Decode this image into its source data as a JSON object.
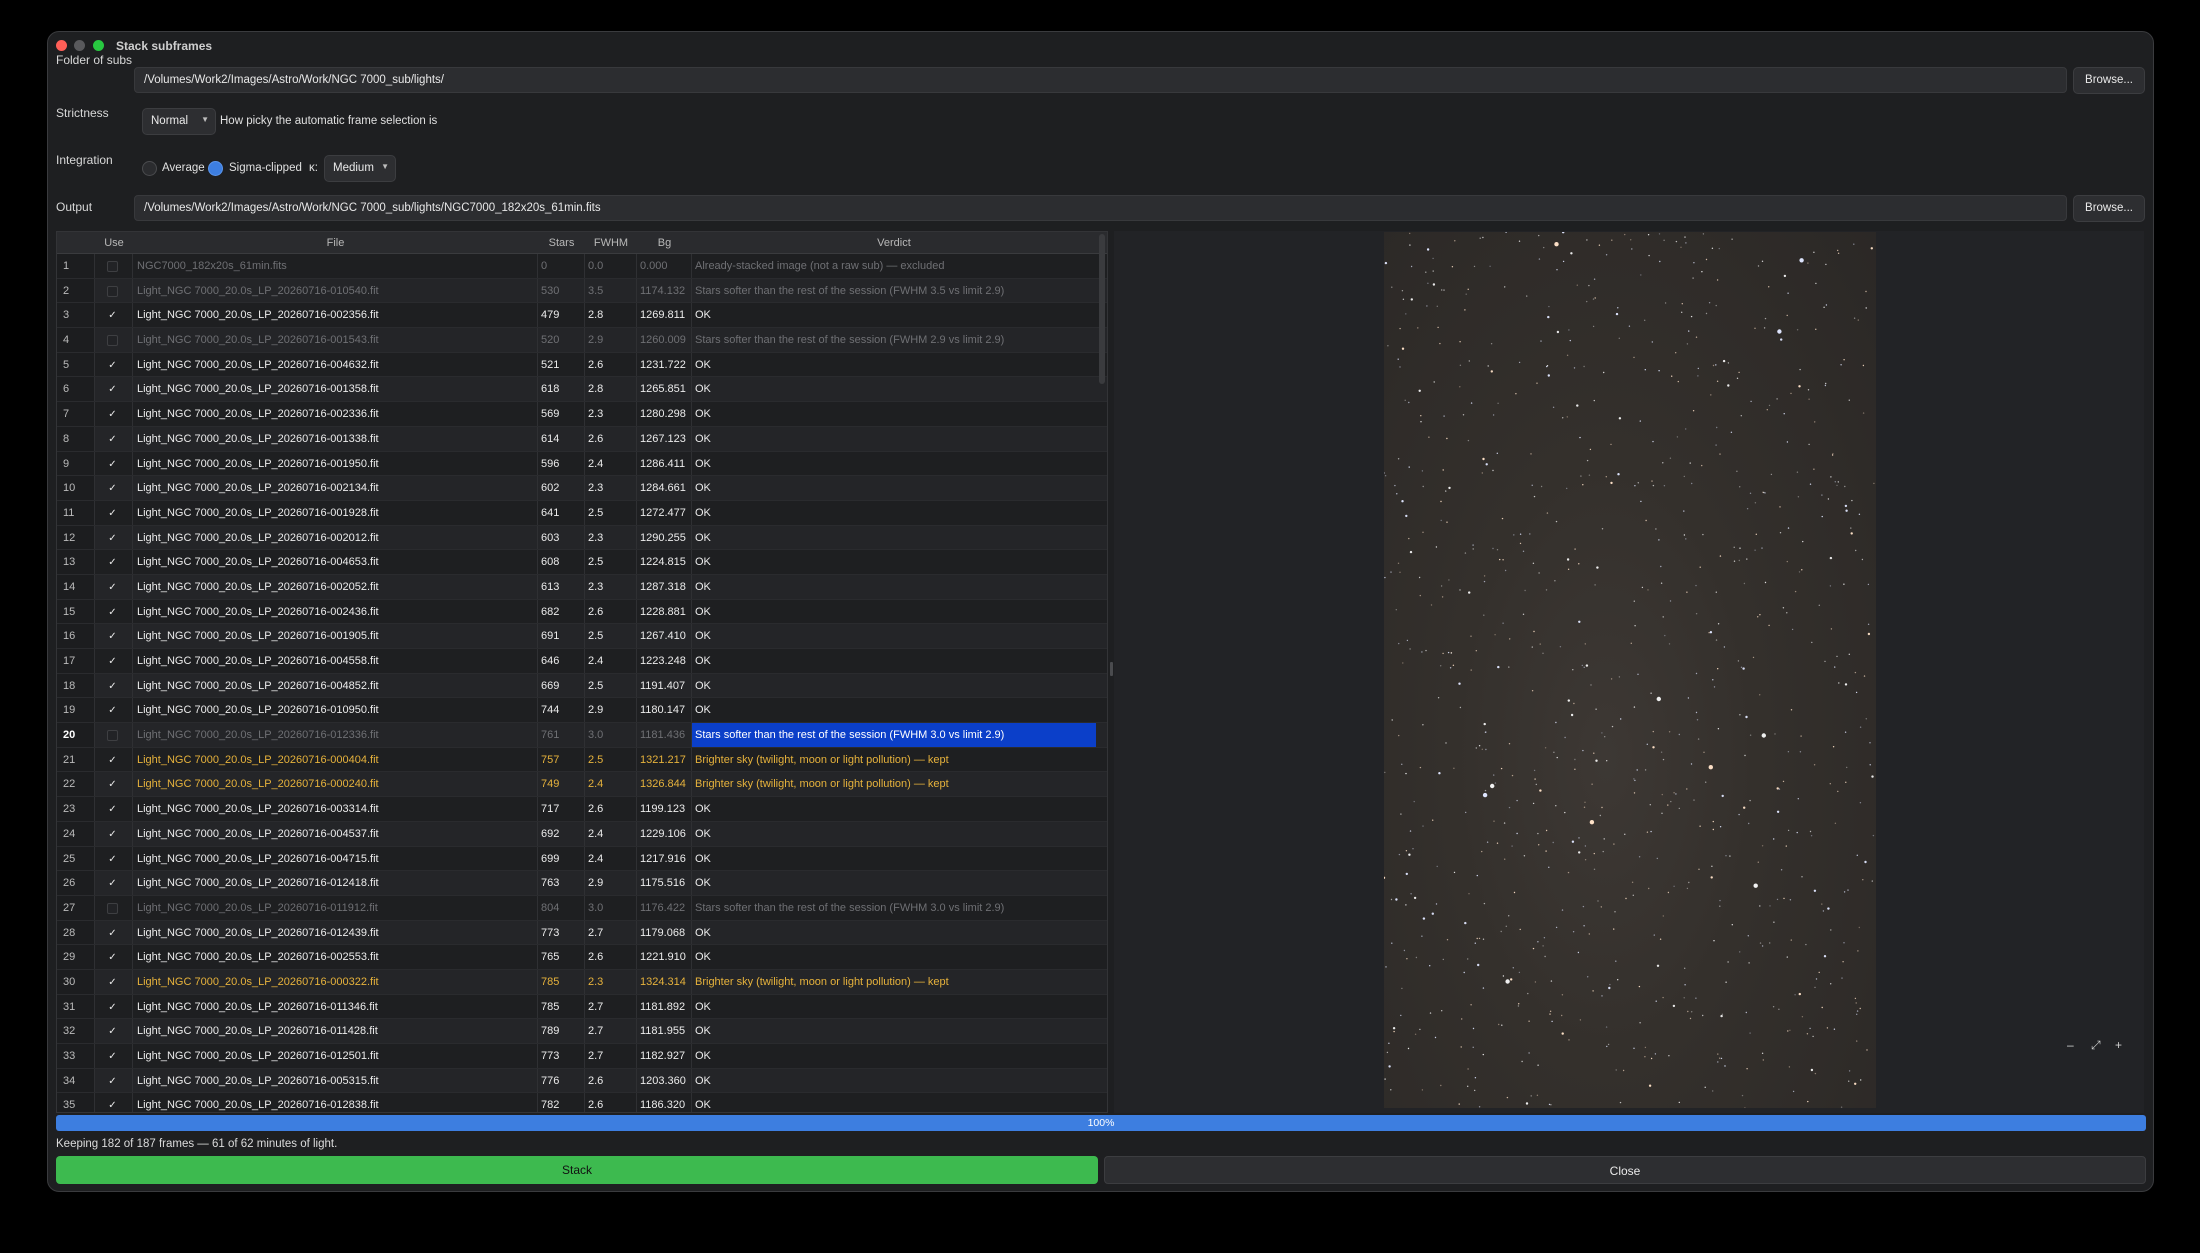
{
  "window": {
    "title": "Stack subframes"
  },
  "folder": {
    "label": "Folder of subs",
    "value": "/Volumes/Work2/Images/Astro/Work/NGC 7000_sub/lights/",
    "browse": "Browse..."
  },
  "strictness": {
    "label": "Strictness",
    "selected": "Normal",
    "hint": "How picky the automatic frame selection is"
  },
  "integration": {
    "label": "Integration",
    "average": "Average",
    "sigma": "Sigma-clipped",
    "kappa_label": "κ:",
    "kappa_selected": "Medium",
    "selected_mode": "sigma"
  },
  "output": {
    "label": "Output",
    "value": "/Volumes/Work2/Images/Astro/Work/NGC 7000_sub/lights/NGC7000_182x20s_61min.fits",
    "browse": "Browse..."
  },
  "table": {
    "headers": {
      "use": "Use",
      "file": "File",
      "stars": "Stars",
      "fwhm": "FWHM",
      "bg": "Bg",
      "verdict": "Verdict"
    },
    "rows": [
      {
        "n": "1",
        "use": false,
        "file": "NGC7000_182x20s_61min.fits",
        "stars": "0",
        "fwhm": "0.0",
        "bg": "0.000",
        "verdict": "Already-stacked image (not a raw sub) — excluded",
        "state": "excluded"
      },
      {
        "n": "2",
        "use": false,
        "file": "Light_NGC 7000_20.0s_LP_20260716-010540.fit",
        "stars": "530",
        "fwhm": "3.5",
        "bg": "1174.132",
        "verdict": "Stars softer than the rest of the session (FWHM 3.5 vs limit 2.9)",
        "state": "excluded"
      },
      {
        "n": "3",
        "use": true,
        "file": "Light_NGC 7000_20.0s_LP_20260716-002356.fit",
        "stars": "479",
        "fwhm": "2.8",
        "bg": "1269.811",
        "verdict": "OK",
        "state": "ok"
      },
      {
        "n": "4",
        "use": false,
        "file": "Light_NGC 7000_20.0s_LP_20260716-001543.fit",
        "stars": "520",
        "fwhm": "2.9",
        "bg": "1260.009",
        "verdict": "Stars softer than the rest of the session (FWHM 2.9 vs limit 2.9)",
        "state": "excluded"
      },
      {
        "n": "5",
        "use": true,
        "file": "Light_NGC 7000_20.0s_LP_20260716-004632.fit",
        "stars": "521",
        "fwhm": "2.6",
        "bg": "1231.722",
        "verdict": "OK",
        "state": "ok"
      },
      {
        "n": "6",
        "use": true,
        "file": "Light_NGC 7000_20.0s_LP_20260716-001358.fit",
        "stars": "618",
        "fwhm": "2.8",
        "bg": "1265.851",
        "verdict": "OK",
        "state": "ok"
      },
      {
        "n": "7",
        "use": true,
        "file": "Light_NGC 7000_20.0s_LP_20260716-002336.fit",
        "stars": "569",
        "fwhm": "2.3",
        "bg": "1280.298",
        "verdict": "OK",
        "state": "ok"
      },
      {
        "n": "8",
        "use": true,
        "file": "Light_NGC 7000_20.0s_LP_20260716-001338.fit",
        "stars": "614",
        "fwhm": "2.6",
        "bg": "1267.123",
        "verdict": "OK",
        "state": "ok"
      },
      {
        "n": "9",
        "use": true,
        "file": "Light_NGC 7000_20.0s_LP_20260716-001950.fit",
        "stars": "596",
        "fwhm": "2.4",
        "bg": "1286.411",
        "verdict": "OK",
        "state": "ok"
      },
      {
        "n": "10",
        "use": true,
        "file": "Light_NGC 7000_20.0s_LP_20260716-002134.fit",
        "stars": "602",
        "fwhm": "2.3",
        "bg": "1284.661",
        "verdict": "OK",
        "state": "ok"
      },
      {
        "n": "11",
        "use": true,
        "file": "Light_NGC 7000_20.0s_LP_20260716-001928.fit",
        "stars": "641",
        "fwhm": "2.5",
        "bg": "1272.477",
        "verdict": "OK",
        "state": "ok"
      },
      {
        "n": "12",
        "use": true,
        "file": "Light_NGC 7000_20.0s_LP_20260716-002012.fit",
        "stars": "603",
        "fwhm": "2.3",
        "bg": "1290.255",
        "verdict": "OK",
        "state": "ok"
      },
      {
        "n": "13",
        "use": true,
        "file": "Light_NGC 7000_20.0s_LP_20260716-004653.fit",
        "stars": "608",
        "fwhm": "2.5",
        "bg": "1224.815",
        "verdict": "OK",
        "state": "ok"
      },
      {
        "n": "14",
        "use": true,
        "file": "Light_NGC 7000_20.0s_LP_20260716-002052.fit",
        "stars": "613",
        "fwhm": "2.3",
        "bg": "1287.318",
        "verdict": "OK",
        "state": "ok"
      },
      {
        "n": "15",
        "use": true,
        "file": "Light_NGC 7000_20.0s_LP_20260716-002436.fit",
        "stars": "682",
        "fwhm": "2.6",
        "bg": "1228.881",
        "verdict": "OK",
        "state": "ok"
      },
      {
        "n": "16",
        "use": true,
        "file": "Light_NGC 7000_20.0s_LP_20260716-001905.fit",
        "stars": "691",
        "fwhm": "2.5",
        "bg": "1267.410",
        "verdict": "OK",
        "state": "ok"
      },
      {
        "n": "17",
        "use": true,
        "file": "Light_NGC 7000_20.0s_LP_20260716-004558.fit",
        "stars": "646",
        "fwhm": "2.4",
        "bg": "1223.248",
        "verdict": "OK",
        "state": "ok"
      },
      {
        "n": "18",
        "use": true,
        "file": "Light_NGC 7000_20.0s_LP_20260716-004852.fit",
        "stars": "669",
        "fwhm": "2.5",
        "bg": "1191.407",
        "verdict": "OK",
        "state": "ok"
      },
      {
        "n": "19",
        "use": true,
        "file": "Light_NGC 7000_20.0s_LP_20260716-010950.fit",
        "stars": "744",
        "fwhm": "2.9",
        "bg": "1180.147",
        "verdict": "OK",
        "state": "ok"
      },
      {
        "n": "20",
        "use": false,
        "file": "Light_NGC 7000_20.0s_LP_20260716-012336.fit",
        "stars": "761",
        "fwhm": "3.0",
        "bg": "1181.436",
        "verdict": "Stars softer than the rest of the session (FWHM 3.0 vs limit 2.9)",
        "state": "excluded",
        "selected": true
      },
      {
        "n": "21",
        "use": true,
        "file": "Light_NGC 7000_20.0s_LP_20260716-000404.fit",
        "stars": "757",
        "fwhm": "2.5",
        "bg": "1321.217",
        "verdict": "Brighter sky (twilight, moon or light pollution) — kept",
        "state": "warn"
      },
      {
        "n": "22",
        "use": true,
        "file": "Light_NGC 7000_20.0s_LP_20260716-000240.fit",
        "stars": "749",
        "fwhm": "2.4",
        "bg": "1326.844",
        "verdict": "Brighter sky (twilight, moon or light pollution) — kept",
        "state": "warn"
      },
      {
        "n": "23",
        "use": true,
        "file": "Light_NGC 7000_20.0s_LP_20260716-003314.fit",
        "stars": "717",
        "fwhm": "2.6",
        "bg": "1199.123",
        "verdict": "OK",
        "state": "ok"
      },
      {
        "n": "24",
        "use": true,
        "file": "Light_NGC 7000_20.0s_LP_20260716-004537.fit",
        "stars": "692",
        "fwhm": "2.4",
        "bg": "1229.106",
        "verdict": "OK",
        "state": "ok"
      },
      {
        "n": "25",
        "use": true,
        "file": "Light_NGC 7000_20.0s_LP_20260716-004715.fit",
        "stars": "699",
        "fwhm": "2.4",
        "bg": "1217.916",
        "verdict": "OK",
        "state": "ok"
      },
      {
        "n": "26",
        "use": true,
        "file": "Light_NGC 7000_20.0s_LP_20260716-012418.fit",
        "stars": "763",
        "fwhm": "2.9",
        "bg": "1175.516",
        "verdict": "OK",
        "state": "ok"
      },
      {
        "n": "27",
        "use": false,
        "file": "Light_NGC 7000_20.0s_LP_20260716-011912.fit",
        "stars": "804",
        "fwhm": "3.0",
        "bg": "1176.422",
        "verdict": "Stars softer than the rest of the session (FWHM 3.0 vs limit 2.9)",
        "state": "excluded"
      },
      {
        "n": "28",
        "use": true,
        "file": "Light_NGC 7000_20.0s_LP_20260716-012439.fit",
        "stars": "773",
        "fwhm": "2.7",
        "bg": "1179.068",
        "verdict": "OK",
        "state": "ok"
      },
      {
        "n": "29",
        "use": true,
        "file": "Light_NGC 7000_20.0s_LP_20260716-002553.fit",
        "stars": "765",
        "fwhm": "2.6",
        "bg": "1221.910",
        "verdict": "OK",
        "state": "ok"
      },
      {
        "n": "30",
        "use": true,
        "file": "Light_NGC 7000_20.0s_LP_20260716-000322.fit",
        "stars": "785",
        "fwhm": "2.3",
        "bg": "1324.314",
        "verdict": "Brighter sky (twilight, moon or light pollution) — kept",
        "state": "warn"
      },
      {
        "n": "31",
        "use": true,
        "file": "Light_NGC 7000_20.0s_LP_20260716-011346.fit",
        "stars": "785",
        "fwhm": "2.7",
        "bg": "1181.892",
        "verdict": "OK",
        "state": "ok"
      },
      {
        "n": "32",
        "use": true,
        "file": "Light_NGC 7000_20.0s_LP_20260716-011428.fit",
        "stars": "789",
        "fwhm": "2.7",
        "bg": "1181.955",
        "verdict": "OK",
        "state": "ok"
      },
      {
        "n": "33",
        "use": true,
        "file": "Light_NGC 7000_20.0s_LP_20260716-012501.fit",
        "stars": "773",
        "fwhm": "2.7",
        "bg": "1182.927",
        "verdict": "OK",
        "state": "ok"
      },
      {
        "n": "34",
        "use": true,
        "file": "Light_NGC 7000_20.0s_LP_20260716-005315.fit",
        "stars": "776",
        "fwhm": "2.6",
        "bg": "1203.360",
        "verdict": "OK",
        "state": "ok"
      },
      {
        "n": "35",
        "use": true,
        "file": "Light_NGC 7000_20.0s_LP_20260716-012838.fit",
        "stars": "782",
        "fwhm": "2.6",
        "bg": "1186.320",
        "verdict": "OK",
        "state": "ok"
      }
    ]
  },
  "preview": {
    "zoom_out": "–",
    "fit": "⤢",
    "zoom_in": "+"
  },
  "progress": {
    "label": "100%",
    "value": 1.0
  },
  "status": "Keeping 182 of 187 frames — 61 of 62 minutes of light.",
  "actions": {
    "stack": "Stack",
    "close": "Close"
  },
  "colors": {
    "accent": "#3d7ee0",
    "stack": "#3dba4f",
    "warn": "#e6b23c",
    "selection": "#0b3fc9"
  }
}
